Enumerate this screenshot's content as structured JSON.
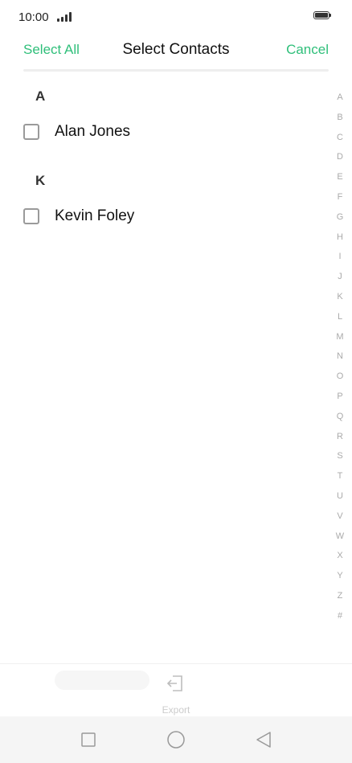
{
  "status_bar": {
    "time": "10:00"
  },
  "header": {
    "select_all": "Select All",
    "title": "Select Contacts",
    "cancel": "Cancel"
  },
  "colors": {
    "accent": "#2fbf7a",
    "index_text": "#aaaaaa"
  },
  "sections": [
    {
      "letter": "A",
      "contacts": [
        {
          "name": "Alan Jones",
          "checked": false
        }
      ]
    },
    {
      "letter": "K",
      "contacts": [
        {
          "name": "Kevin Foley",
          "checked": false
        }
      ]
    }
  ],
  "index": [
    "A",
    "B",
    "C",
    "D",
    "E",
    "F",
    "G",
    "H",
    "I",
    "J",
    "K",
    "L",
    "M",
    "N",
    "O",
    "P",
    "Q",
    "R",
    "S",
    "T",
    "U",
    "V",
    "W",
    "X",
    "Y",
    "Z",
    "#"
  ],
  "bottom": {
    "export_label": "Export",
    "export_icon": "export-icon"
  },
  "nav": {
    "icons": [
      "square-icon",
      "circle-icon",
      "back-triangle-icon"
    ]
  }
}
